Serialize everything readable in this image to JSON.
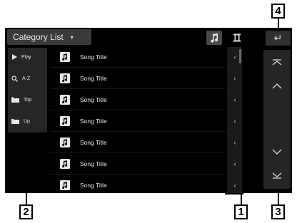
{
  "header": {
    "category_label": "Category List",
    "dropdown_arrow": "▾",
    "back_glyph": "↵"
  },
  "left_panel": [
    {
      "icon": "play-icon",
      "label": "Play"
    },
    {
      "icon": "search-icon",
      "label": "A-Z"
    },
    {
      "icon": "folder-top-icon",
      "label": "Top"
    },
    {
      "icon": "folder-up-icon",
      "label": "Up"
    }
  ],
  "rows": [
    {
      "title": "Song Title",
      "marker": "‹"
    },
    {
      "title": "Song Title",
      "marker": "‹"
    },
    {
      "title": "Song Title",
      "marker": "‹"
    },
    {
      "title": "Song Title",
      "marker": "‹"
    },
    {
      "title": "Song Title",
      "marker": "‹"
    },
    {
      "title": "Song Title",
      "marker": "‹"
    },
    {
      "title": "Song Title",
      "marker": "‹"
    }
  ],
  "right_panel": [
    "page-top-icon",
    "scroll-up-icon",
    "scroll-down-icon",
    "page-bottom-icon"
  ],
  "callouts": {
    "c1": "1",
    "c2": "2",
    "c3": "3",
    "c4": "4"
  },
  "colors": {
    "background": "#000000",
    "panel": "#262626",
    "text": "#e8e8e8"
  }
}
